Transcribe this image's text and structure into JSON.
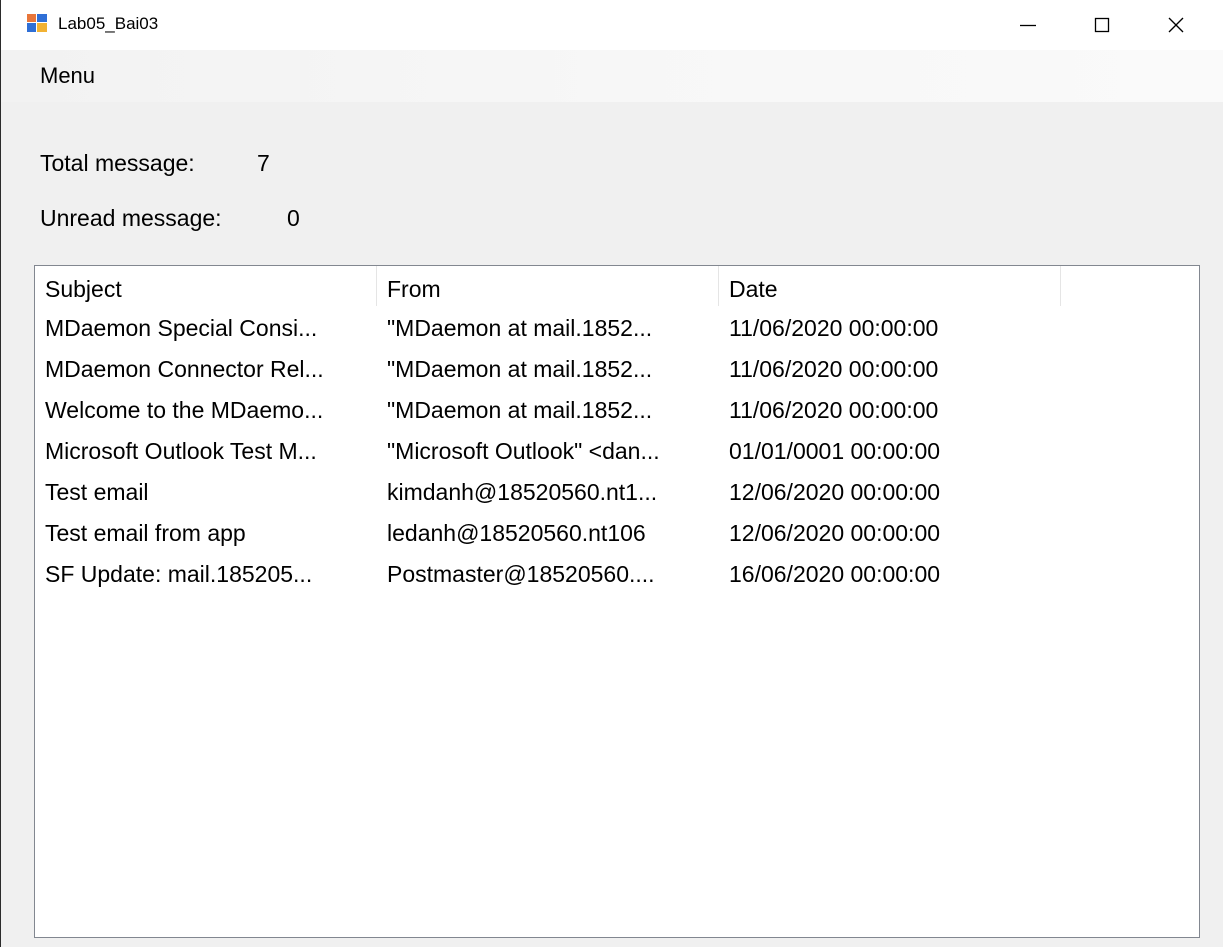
{
  "window": {
    "title": "Lab05_Bai03"
  },
  "menu": {
    "items": [
      {
        "label": "Menu"
      }
    ]
  },
  "stats": {
    "total_label": "Total message:",
    "total_value": "7",
    "unread_label": "Unread message:",
    "unread_value": "0"
  },
  "listview": {
    "columns": [
      {
        "label": "Subject"
      },
      {
        "label": "From"
      },
      {
        "label": "Date"
      },
      {
        "label": ""
      }
    ],
    "rows": [
      {
        "subject": "MDaemon Special Consi...",
        "from": "\"MDaemon at mail.1852...",
        "date": "11/06/2020 00:00:00"
      },
      {
        "subject": "MDaemon Connector Rel...",
        "from": "\"MDaemon at mail.1852...",
        "date": "11/06/2020 00:00:00"
      },
      {
        "subject": "Welcome to the MDaemo...",
        "from": "\"MDaemon at mail.1852...",
        "date": "11/06/2020 00:00:00"
      },
      {
        "subject": "Microsoft Outlook Test M...",
        "from": "\"Microsoft Outlook\" <dan...",
        "date": "01/01/0001 00:00:00"
      },
      {
        "subject": "Test email",
        "from": "kimdanh@18520560.nt1...",
        "date": "12/06/2020 00:00:00"
      },
      {
        "subject": "Test email from app",
        "from": "ledanh@18520560.nt106",
        "date": "12/06/2020 00:00:00"
      },
      {
        "subject": "SF Update: mail.185205...",
        "from": "Postmaster@18520560....",
        "date": "16/06/2020 00:00:00"
      }
    ]
  },
  "colors": {
    "window_bg": "#f0f0f0",
    "titlebar_bg": "#ffffff",
    "list_border": "#828790",
    "icon_orange": "#e8763a",
    "icon_blue": "#2f6fd6"
  }
}
